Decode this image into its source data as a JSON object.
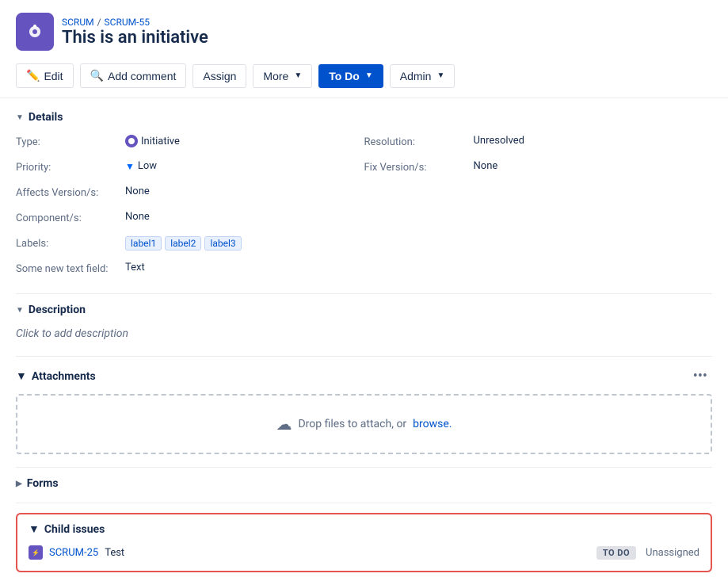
{
  "app": {
    "icon_label": "scrum-app-icon",
    "breadcrumb_project": "SCRUM",
    "breadcrumb_separator": "/",
    "breadcrumb_issue": "SCRUM-55",
    "title": "This is an initiative"
  },
  "toolbar": {
    "edit_label": "Edit",
    "add_comment_label": "Add comment",
    "assign_label": "Assign",
    "more_label": "More",
    "status_label": "To Do",
    "admin_label": "Admin"
  },
  "details": {
    "section_label": "Details",
    "type_label": "Type:",
    "type_value": "Initiative",
    "priority_label": "Priority:",
    "priority_value": "Low",
    "affects_label": "Affects Version/s:",
    "affects_value": "None",
    "components_label": "Component/s:",
    "components_value": "None",
    "labels_label": "Labels:",
    "labels": [
      "label1",
      "label2",
      "label3"
    ],
    "custom_field_label": "Some new text field:",
    "custom_field_value": "Text",
    "resolution_label": "Resolution:",
    "resolution_value": "Unresolved",
    "fix_version_label": "Fix Version/s:",
    "fix_version_value": "None"
  },
  "description": {
    "section_label": "Description",
    "placeholder": "Click to add description"
  },
  "attachments": {
    "section_label": "Attachments",
    "drop_text": "Drop files to attach, or",
    "browse_text": "browse."
  },
  "forms": {
    "section_label": "Forms"
  },
  "child_issues": {
    "section_label": "Child issues",
    "items": [
      {
        "key": "SCRUM-25",
        "name": "Test",
        "status": "TO DO",
        "assignee": "Unassigned"
      }
    ]
  }
}
